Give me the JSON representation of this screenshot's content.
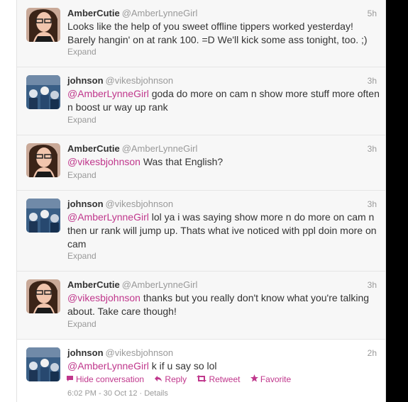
{
  "tweets": [
    {
      "name": "AmberCutie",
      "handle": "@AmberLynneGirl",
      "time": "5h",
      "mention": "",
      "text": "Looks like the help of you sweet offline tippers worked yesterday! Barely hangin' on at rank 100. =D We'll kick some ass tonight, too. ;)",
      "expand": "Expand"
    },
    {
      "name": "johnson",
      "handle": "@vikesbjohnson",
      "time": "3h",
      "mention": "@AmberLynneGirl",
      "text": " goda do more on cam n show more stuff more often n boost ur way up rank",
      "expand": "Expand"
    },
    {
      "name": "AmberCutie",
      "handle": "@AmberLynneGirl",
      "time": "3h",
      "mention": "@vikesbjohnson",
      "text": " Was that English?",
      "expand": "Expand"
    },
    {
      "name": "johnson",
      "handle": "@vikesbjohnson",
      "time": "3h",
      "mention": "@AmberLynneGirl",
      "text": " lol ya i was saying show more n do more on cam n then ur rank will jump up. Thats what ive noticed with ppl doin more on cam",
      "expand": "Expand"
    },
    {
      "name": "AmberCutie",
      "handle": "@AmberLynneGirl",
      "time": "3h",
      "mention": "@vikesbjohnson",
      "text": " thanks but you really don't know what you're talking about. Take care though!",
      "expand": "Expand"
    },
    {
      "name": "johnson",
      "handle": "@vikesbjohnson",
      "time": "2h",
      "mention": "@AmberLynneGirl",
      "text": " k if u say so lol",
      "actions": {
        "hide": "Hide conversation",
        "reply": "Reply",
        "retweet": "Retweet",
        "favorite": "Favorite"
      },
      "footer": "6:02 PM - 30 Oct 12 · Details"
    }
  ],
  "icons": {
    "speech": "speech-bubble-icon",
    "reply": "reply-arrow-icon",
    "retweet": "retweet-icon",
    "favorite": "star-icon"
  },
  "colors": {
    "mention": "#c0378c",
    "muted": "#999999",
    "text": "#333333"
  }
}
